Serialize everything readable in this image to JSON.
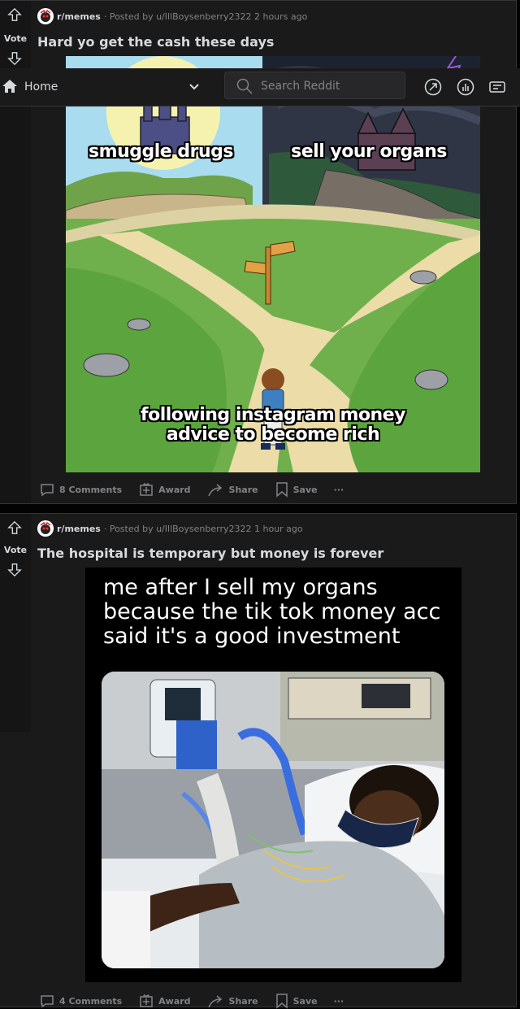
{
  "topbar": {
    "home_label": "Home",
    "search_placeholder": "Search Reddit"
  },
  "posts": [
    {
      "subreddit": "r/memes",
      "posted_by": "· Posted by u/IllBoysenberry2322",
      "time": "2 hours ago",
      "vote_label": "Vote",
      "title": "Hard yo get the cash these days",
      "meme": {
        "caption_left": "smuggle drugs",
        "caption_right": "sell your organs",
        "caption_bottom_line1": "following instagram money",
        "caption_bottom_line2": "advice to become rich"
      },
      "comments_label": "8 Comments",
      "award_label": "Award",
      "share_label": "Share",
      "save_label": "Save",
      "more_label": "···"
    },
    {
      "subreddit": "r/memes",
      "posted_by": "· Posted by u/IllBoysenberry2322",
      "time": "1 hour ago",
      "vote_label": "Vote",
      "title": "The hospital is temporary but money is forever",
      "meme": {
        "line1": "me after I sell my organs",
        "line2": "because the tik tok money acc",
        "line3": "said it's a good investment"
      },
      "comments_label": "4 Comments",
      "award_label": "Award",
      "share_label": "Share",
      "save_label": "Save",
      "more_label": "···"
    }
  ]
}
